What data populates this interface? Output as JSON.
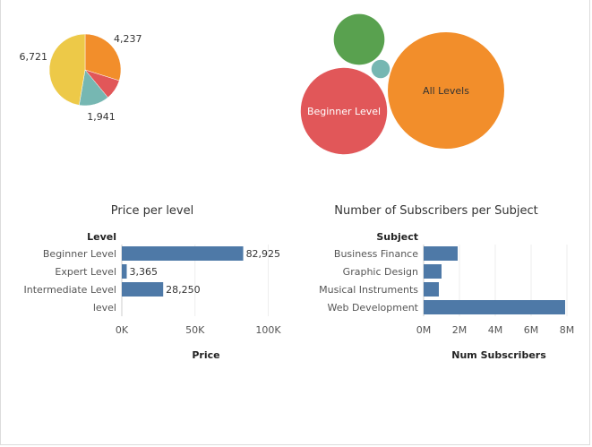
{
  "colors": {
    "bar": "#4e79a7",
    "orange": "#f28e2b",
    "red": "#e15759",
    "teal": "#76b7b2",
    "yellow": "#edc948",
    "green": "#59a14f",
    "grid": "#eeeeee",
    "axis": "#cccccc"
  },
  "chart_data": [
    {
      "type": "pie",
      "slices": [
        {
          "value": 4237,
          "label": "4,237",
          "color": "#f28e2b"
        },
        {
          "value": 1300,
          "label": "",
          "color": "#e15759"
        },
        {
          "value": 1941,
          "label": "1,941",
          "color": "#76b7b2"
        },
        {
          "value": 6721,
          "label": "6,721",
          "color": "#edc948"
        }
      ]
    },
    {
      "type": "bubble",
      "bubbles": [
        {
          "label": "All Levels",
          "value": 100,
          "color": "#f28e2b"
        },
        {
          "label": "Beginner Level",
          "value": 55,
          "color": "#e15759"
        },
        {
          "label": "",
          "value": 19,
          "color": "#59a14f"
        },
        {
          "label": "",
          "value": 2.5,
          "color": "#76b7b2"
        }
      ]
    },
    {
      "type": "bar",
      "title": "Price per level",
      "category_header": "Level",
      "categories": [
        "Beginner Level",
        "Expert Level",
        "Intermediate Level",
        "level"
      ],
      "values": [
        82925,
        3365,
        28250,
        null
      ],
      "value_labels": [
        "82,925",
        "3,365",
        "28,250",
        ""
      ],
      "xlabel": "Price",
      "ticks": [
        0,
        50000,
        100000
      ],
      "tick_labels": [
        "0K",
        "50K",
        "100K"
      ],
      "xlim": [
        0,
        115000
      ]
    },
    {
      "type": "bar",
      "title": "Number of Subscribers per Subject",
      "category_header": "Subject",
      "categories": [
        "Business Finance",
        "Graphic Design",
        "Musical Instruments",
        "Web Development"
      ],
      "values": [
        1900000,
        1000000,
        850000,
        7900000
      ],
      "xlabel": "Num Subscribers",
      "ticks": [
        0,
        2000000,
        4000000,
        6000000,
        8000000
      ],
      "tick_labels": [
        "0M",
        "2M",
        "4M",
        "6M",
        "8M"
      ],
      "xlim": [
        0,
        8000000
      ]
    }
  ]
}
